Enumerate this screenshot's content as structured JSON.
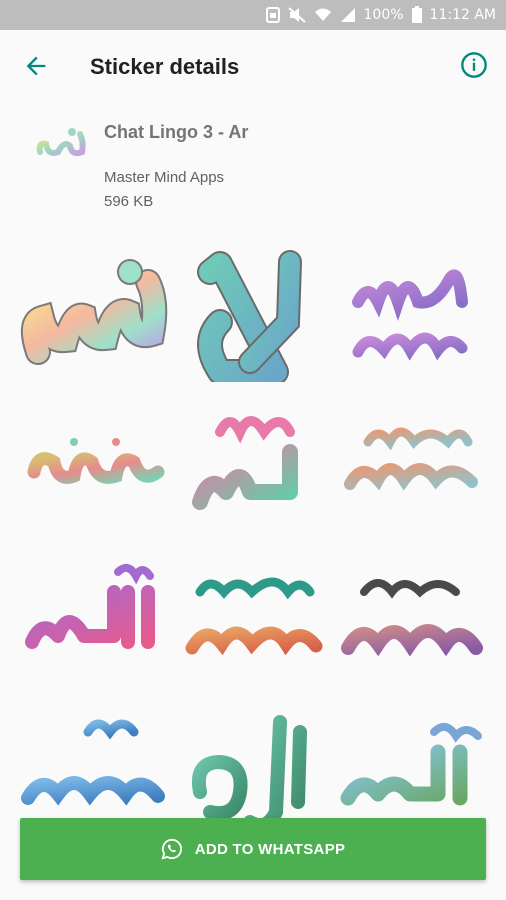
{
  "status": {
    "battery": "100%",
    "time": "11:12 AM"
  },
  "appbar": {
    "title": "Sticker details"
  },
  "pack": {
    "name": "Chat Lingo 3 - Ar",
    "publisher": "Master Mind Apps",
    "size": "596 KB"
  },
  "action": {
    "label": "ADD TO WHATSAPP"
  },
  "colors": {
    "accent": "#00897b",
    "green": "#4caf50"
  }
}
